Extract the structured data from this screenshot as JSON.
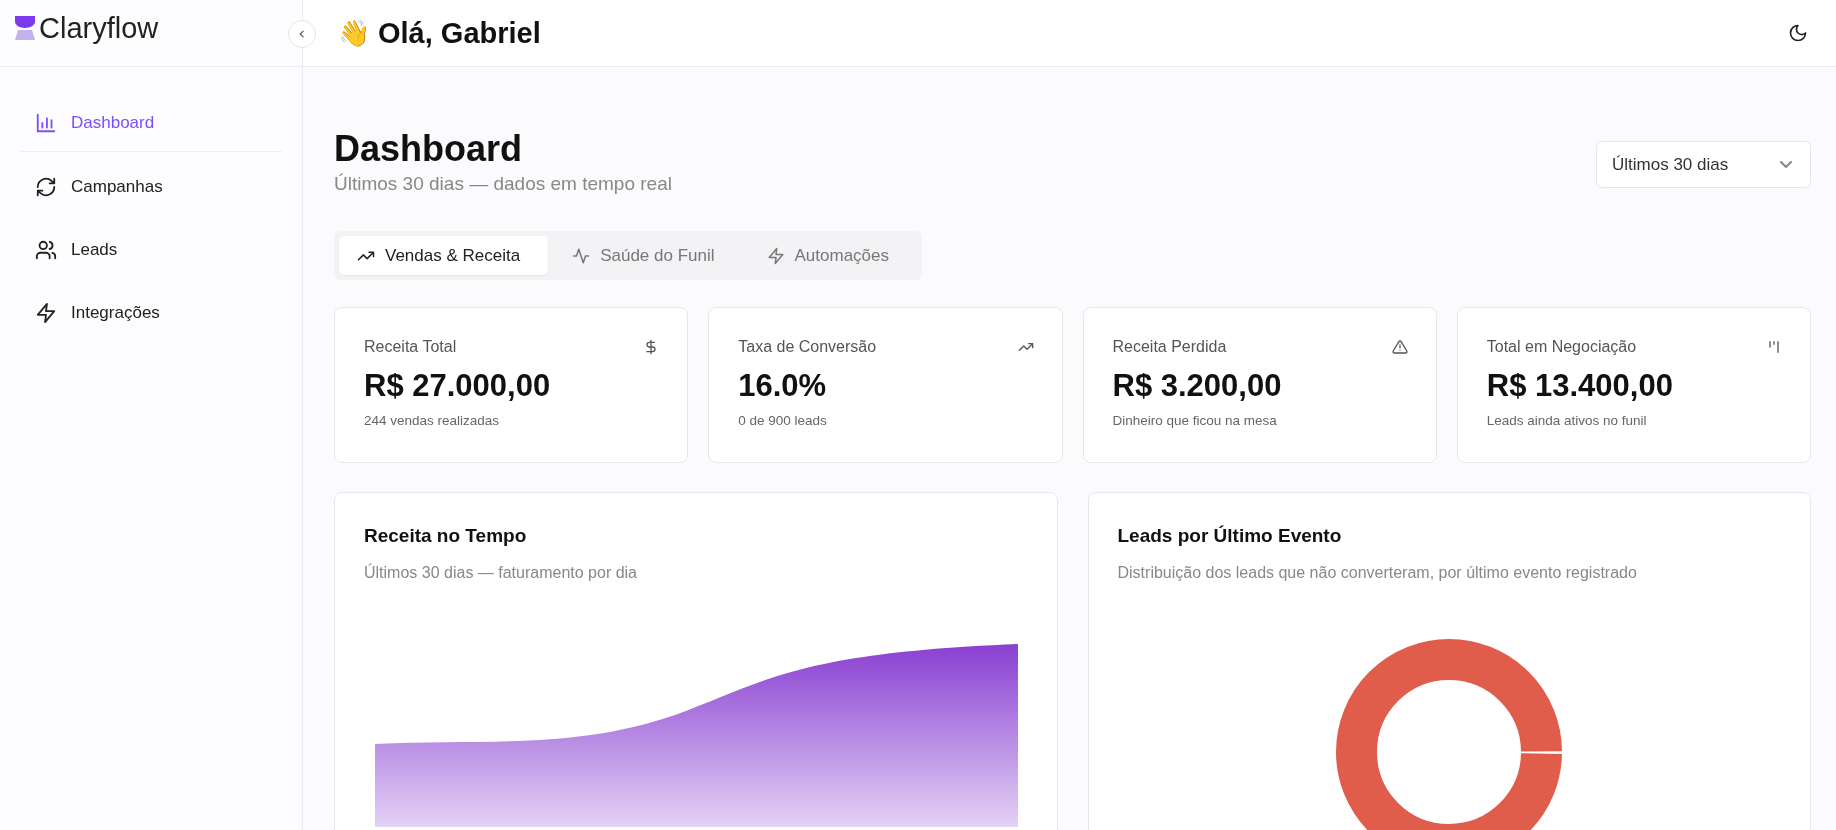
{
  "brand": {
    "name": "Claryflow"
  },
  "header": {
    "greeting_emoji": "👋",
    "greeting": "Olá, Gabriel"
  },
  "sidebar": {
    "items": [
      {
        "label": "Dashboard",
        "selected": true
      },
      {
        "label": "Campanhas",
        "selected": false
      },
      {
        "label": "Leads",
        "selected": false
      },
      {
        "label": "Integrações",
        "selected": false
      }
    ]
  },
  "page": {
    "title": "Dashboard",
    "subtitle": "Últimos 30 dias — dados em tempo real",
    "period": {
      "value": "Últimos 30 dias"
    }
  },
  "tabs": [
    {
      "label": "Vendas & Receita",
      "selected": true
    },
    {
      "label": "Saúde do Funil",
      "selected": false
    },
    {
      "label": "Automações",
      "selected": false
    }
  ],
  "stats": [
    {
      "label": "Receita Total",
      "value": "R$ 27.000,00",
      "note": "244 vendas realizadas"
    },
    {
      "label": "Taxa de Conversão",
      "value": "16.0%",
      "note": "0 de 900 leads"
    },
    {
      "label": "Receita Perdida",
      "value": "R$ 3.200,00",
      "note": "Dinheiro que ficou na mesa"
    },
    {
      "label": "Total em Negociação",
      "value": "R$ 13.400,00",
      "note": "Leads ainda ativos no funil"
    }
  ],
  "panels": [
    {
      "title": "Receita no Tempo",
      "subtitle": "Últimos 30 dias — faturamento por dia",
      "kind": "area"
    },
    {
      "title": "Leads por Último Evento",
      "subtitle": "Distribuição dos leads que não converteram, por último evento registrado",
      "kind": "donut"
    }
  ]
}
